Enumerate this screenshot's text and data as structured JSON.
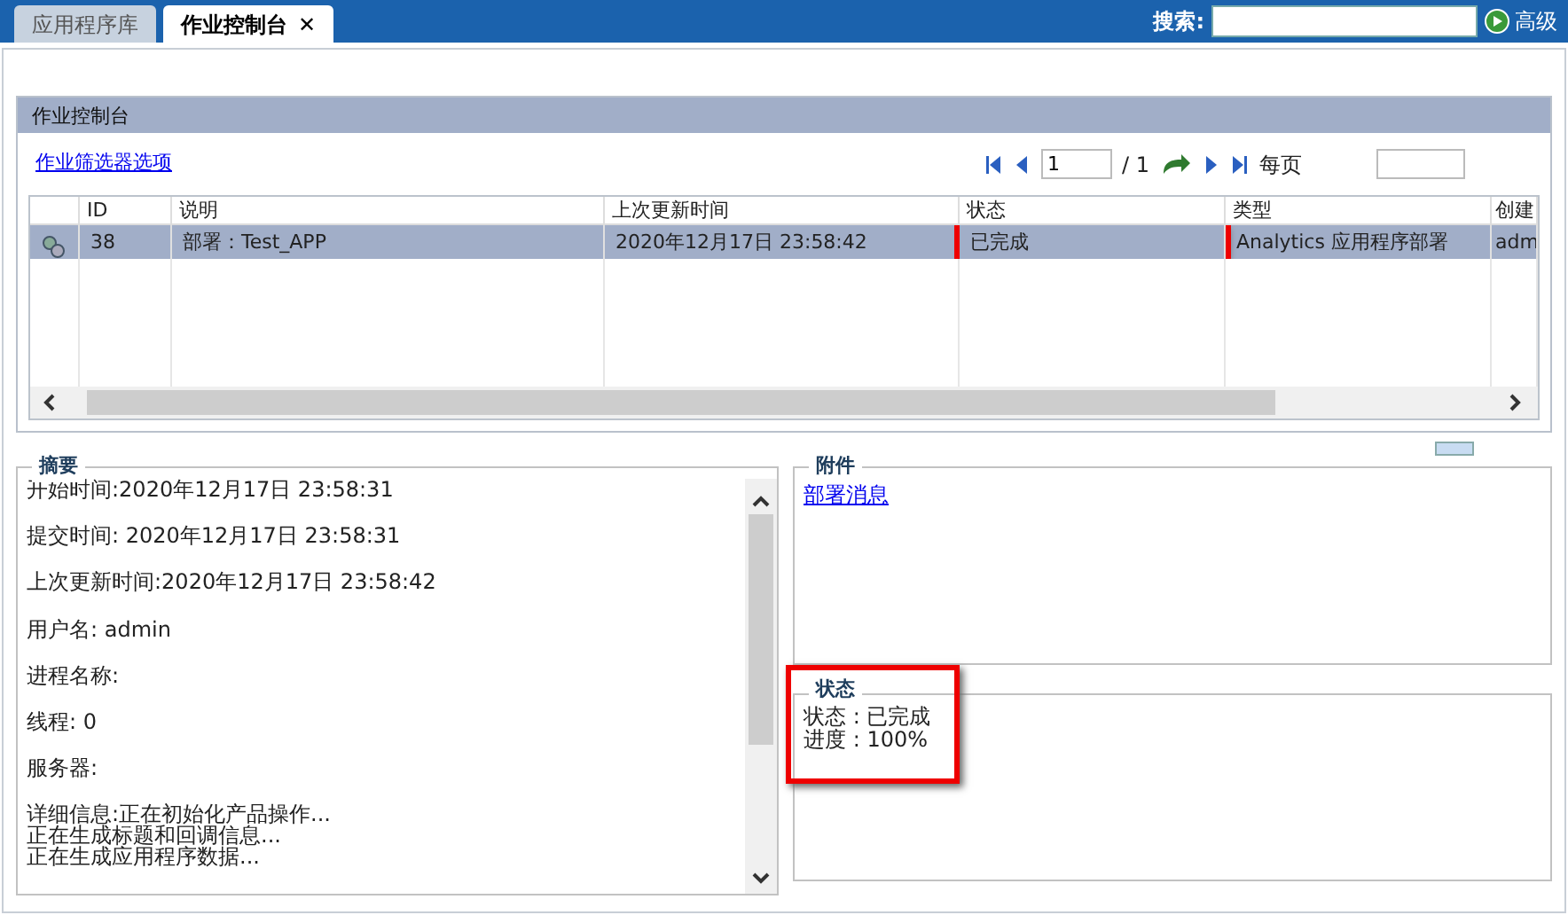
{
  "tabs": [
    {
      "label": "应用程序库",
      "selected": false
    },
    {
      "label": "作业控制台",
      "selected": true,
      "close": "✕"
    }
  ],
  "search": {
    "label": "搜索:",
    "advanced": "高级"
  },
  "panel": {
    "title": "作业控制台",
    "filter_link": "作业筛选器选项",
    "page": "1",
    "page_total": "/ 1",
    "per_page_label": "每页"
  },
  "table": {
    "columns": [
      "ID",
      "说明",
      "上次更新时间",
      "状态",
      "类型",
      "创建"
    ],
    "rows": [
      {
        "selected": true,
        "cells": [
          {
            "text": "38",
            "highlighted": false
          },
          {
            "text": "部署：Test_APP",
            "highlighted": false
          },
          {
            "text": "2020年12月17日 23:58:42",
            "highlighted": false
          },
          {
            "text": "已完成",
            "highlighted": true
          },
          {
            "text": "Analytics 应用程序部署",
            "highlighted": false
          },
          {
            "text": "adm",
            "highlighted": false
          }
        ]
      }
    ]
  },
  "summary": {
    "title": "摘要",
    "lines": [
      "开始时间:2020年12月17日 23:58:31",
      "提交时间: 2020年12月17日 23:58:31",
      "上次更新时间:2020年12月17日 23:58:42",
      "用户名: admin",
      "进程名称:",
      "线程: 0",
      "服务器:"
    ],
    "details": [
      "详细信息:正在初始化产品操作...",
      "正在生成标题和回调信息...",
      "正在生成应用程序数据..."
    ]
  },
  "attachments": {
    "title": "附件",
    "links": [
      "部署消息"
    ]
  },
  "status": {
    "title": "状态",
    "highlighted": true,
    "lines": [
      "状态 : 已完成",
      "进度 : 100%"
    ]
  }
}
